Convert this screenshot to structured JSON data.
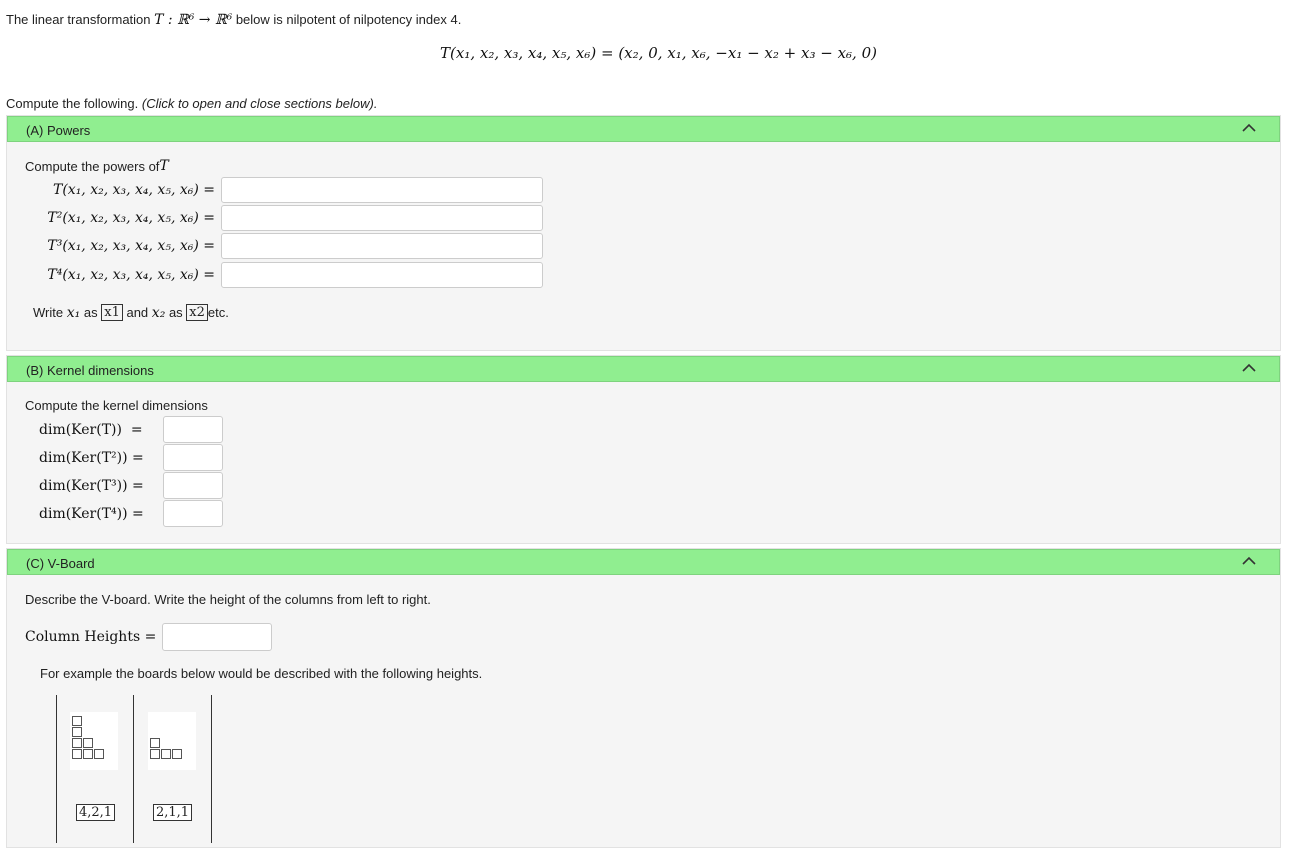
{
  "intro": {
    "prefix": "The linear transformation ",
    "map": "T : ℝ⁶ → ℝ⁶",
    "suffix": " below is nilpotent of nilpotency index 4."
  },
  "formula": "T(x₁, x₂, x₃, x₄, x₅, x₆) = (x₂, 0, x₁, x₆, −x₁ − x₂ + x₃ − x₆, 0)",
  "compute_prompt": "Compute the following.",
  "compute_hint": "(Click to open and close sections below).",
  "section_a": {
    "title": "(A) Powers",
    "prompt": "Compute the powers of ",
    "prompt_var": "T",
    "rows": [
      {
        "label": "T(x₁, x₂, x₃, x₄, x₅, x₆) =",
        "value": ""
      },
      {
        "label": "T²(x₁, x₂, x₃, x₄, x₅, x₆) =",
        "value": ""
      },
      {
        "label": "T³(x₁, x₂, x₃, x₄, x₅, x₆) =",
        "value": ""
      },
      {
        "label": "T⁴(x₁, x₂, x₃, x₄, x₅, x₆) =",
        "value": ""
      }
    ],
    "hint_write": "Write ",
    "hint_x1": "x₁",
    "hint_as1": " as ",
    "hint_x1_box": "x1",
    "hint_and": " and ",
    "hint_x2": "x₂",
    "hint_as2": " as ",
    "hint_x2_box": "x2",
    "hint_etc": " etc."
  },
  "section_b": {
    "title": "(B) Kernel dimensions",
    "prompt": "Compute the kernel dimensions",
    "rows": [
      {
        "label": "dim(Ker(T))  =",
        "value": ""
      },
      {
        "label": "dim(Ker(T²)) =",
        "value": ""
      },
      {
        "label": "dim(Ker(T³)) =",
        "value": ""
      },
      {
        "label": "dim(Ker(T⁴)) =",
        "value": ""
      }
    ]
  },
  "section_c": {
    "title": "(C) V-Board",
    "prompt": "Describe the V-board. Write the height of the columns from left to right.",
    "column_heights_label": "Column Heights =",
    "column_heights_value": "",
    "example_text": "For example the boards below would be described with the following heights.",
    "examples": [
      {
        "caption": "4,2,1",
        "heights": [
          4,
          2,
          1
        ]
      },
      {
        "caption": "2,1,1",
        "heights": [
          2,
          1,
          1
        ]
      }
    ]
  },
  "colors": {
    "section_header": "#90ee90",
    "section_body": "#f5f5f5"
  }
}
